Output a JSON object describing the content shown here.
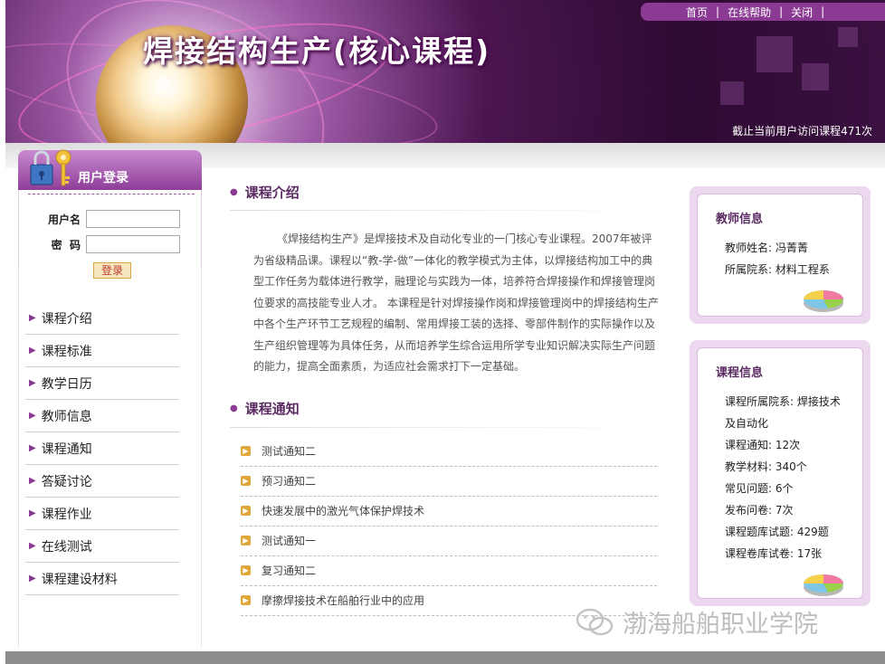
{
  "banner": {
    "title": "焊接结构生产(核心课程)",
    "topnav": [
      "首页",
      "在线帮助",
      "关闭"
    ],
    "visit_text": "截止当前用户访问课程471次"
  },
  "login": {
    "title": "用户登录",
    "username_label": "用户名",
    "password_label": "密  码",
    "username_value": "",
    "password_value": "",
    "submit_label": "登录"
  },
  "menu": [
    "课程介绍",
    "课程标准",
    "教学日历",
    "教师信息",
    "课程通知",
    "答疑讨论",
    "课程作业",
    "在线测试",
    "课程建设材料"
  ],
  "intro": {
    "title": "课程介绍",
    "text": "《焊接结构生产》是焊接技术及自动化专业的一门核心专业课程。2007年被评为省级精品课。课程以“教-学-做”一体化的教学模式为主体，以焊接结构加工中的典型工作任务为载体进行教学，融理论与实践为一体，培养符合焊接操作和焊接管理岗位要求的高技能专业人才。 本课程是针对焊接操作岗和焊接管理岗中的焊接结构生产中各个生产环节工艺规程的编制、常用焊接工装的选择、零部件制作的实际操作以及生产组织管理等为具体任务，从而培养学生综合运用所学专业知识解决实际生产问题的能力，提高全面素质，为适应社会需求打下一定基础。"
  },
  "notices": {
    "title": "课程通知",
    "items": [
      "测试通知二",
      "预习通知二",
      "快速发展中的激光气体保护焊技术",
      "测试通知一",
      "复习通知二",
      "摩擦焊接技术在船舶行业中的应用"
    ]
  },
  "teacher": {
    "title": "教师信息",
    "name": "教师姓名: 冯菁菁",
    "dept": "所属院系: 材料工程系"
  },
  "course": {
    "title": "课程信息",
    "dept_line1": "课程所属院系: 焊接技术",
    "dept_line2": "及自动化",
    "notices": "课程通知: 12次",
    "materials": "教学材料: 340个",
    "faq": "常见问题: 6个",
    "surveys": "发布问卷: 7次",
    "question_bank": "课程题库试题: 429题",
    "paper_bank": "课程卷库试卷: 17张"
  },
  "watermark": "渤海船舶职业学院",
  "colors": {
    "brand_purple": "#8a3a92",
    "title_purple": "#5a2a62",
    "bullet_orange": "#e0a73a"
  }
}
